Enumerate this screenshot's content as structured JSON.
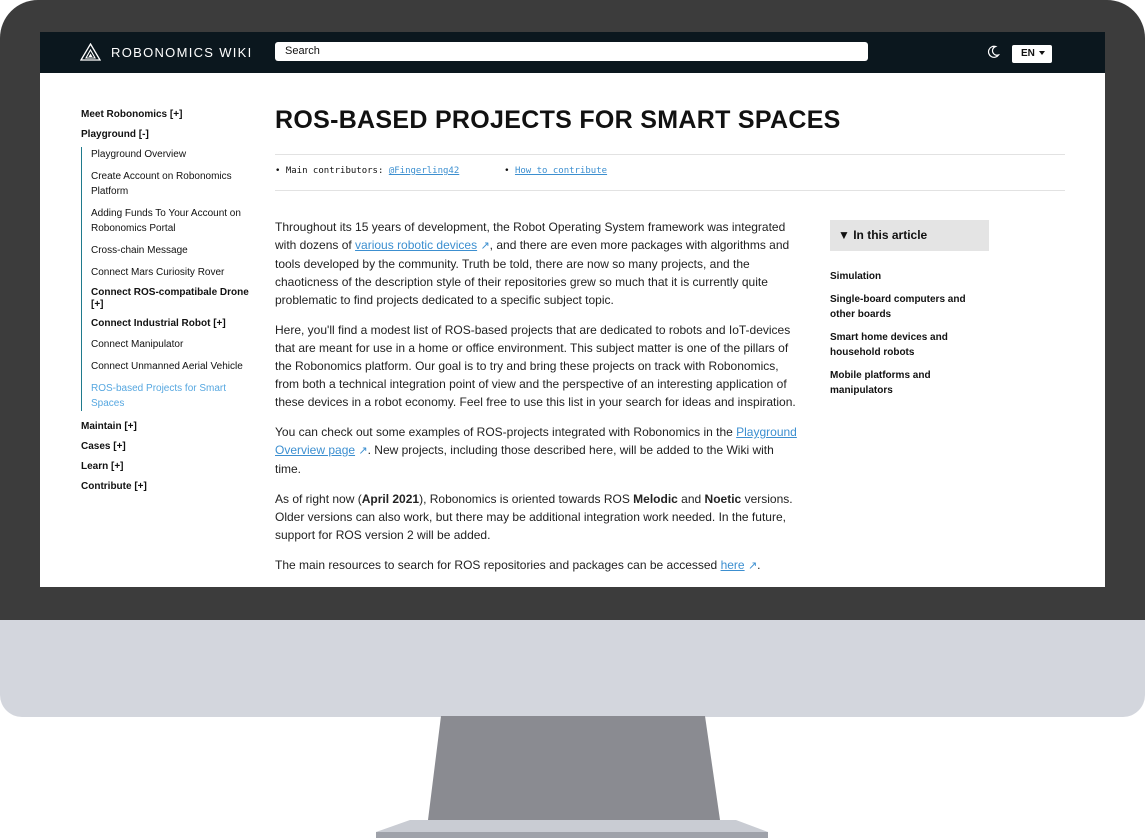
{
  "header": {
    "logo_text": "ROBONOMICS WIKI",
    "search_placeholder": "Search",
    "theme_icon": "moon-icon",
    "language": "EN"
  },
  "sidebar": {
    "sections": [
      {
        "label": "Meet Robonomics [+]"
      },
      {
        "label": "Playground [-]"
      }
    ],
    "playground_items": [
      {
        "label": "Playground Overview",
        "style": "normal"
      },
      {
        "label": "Create Account on Robonomics Platform",
        "style": "normal"
      },
      {
        "label": "Adding Funds To Your Account on Robonomics Portal",
        "style": "normal"
      },
      {
        "label": "Cross-chain Message",
        "style": "normal"
      },
      {
        "label": "Connect Mars Curiosity Rover",
        "style": "normal"
      },
      {
        "label": "Connect ROS-compatibale Drone [+]",
        "style": "bold"
      },
      {
        "label": "Connect Industrial Robot [+]",
        "style": "bold"
      },
      {
        "label": "Connect Manipulator",
        "style": "normal"
      },
      {
        "label": "Connect Unmanned Aerial Vehicle",
        "style": "normal"
      },
      {
        "label": "ROS-based Projects for Smart Spaces",
        "style": "active"
      }
    ],
    "more_sections": [
      {
        "label": "Maintain [+]"
      },
      {
        "label": "Cases [+]"
      },
      {
        "label": "Learn [+]"
      },
      {
        "label": "Contribute [+]"
      }
    ]
  },
  "main": {
    "title": "ROS-BASED PROJECTS FOR SMART SPACES",
    "contributors_label": "Main contributors:",
    "contributor": "@Fingerling42",
    "how_to_contribute": "How to contribute",
    "p1_a": "Throughout its 15 years of development, the Robot Operating System framework was integrated with dozens of ",
    "p1_link": "various robotic devices",
    "p1_b": ", and there are even more packages with algorithms and tools developed by the community. Truth be told, there are now so many projects, and the chaoticness of the description style of their repositories grew so much that it is currently quite problematic to find projects dedicated to a specific subject topic.",
    "p2": "Here, you'll find a modest list of ROS-based projects that are dedicated to robots and IoT-devices that are meant for use in a home or office environment. This subject matter is one of the pillars of the Robonomics platform. Our goal is to try and bring these projects on track with Robonomics, from both a technical integration point of view and the perspective of an interesting application of these devices in a robot economy. Feel free to use this list in your search for ideas and inspiration.",
    "p3_a": "You can check out some examples of ROS-projects integrated with Robonomics in the ",
    "p3_link": "Playground Overview page",
    "p3_b": ". New projects, including those described here, will be added to the Wiki with time.",
    "p4_a": "As of right now (",
    "p4_bold1": "April 2021",
    "p4_b": "), Robonomics is oriented towards ROS ",
    "p4_bold2": "Melodic",
    "p4_c": " and ",
    "p4_bold3": "Noetic",
    "p4_d": " versions. Older versions can also work, but there may be additional integration work needed. In the future, support for ROS version 2 will be added.",
    "p5_a": "The main resources to search for ROS repositories and packages can be accessed ",
    "p5_link": "here",
    "p5_b": "."
  },
  "toc": {
    "title": "▼ In this article",
    "items": [
      "Simulation",
      "Single-board computers and other boards",
      "Smart home devices and household robots",
      "Mobile platforms and manipulators"
    ]
  },
  "colors": {
    "header_bg": "#0b171e",
    "link": "#3c8fd0",
    "active_sidebar": "#56a7e0",
    "bezel": "#3c3c3c",
    "chin": "#d3d6dd",
    "stand": "#8a8b91"
  }
}
